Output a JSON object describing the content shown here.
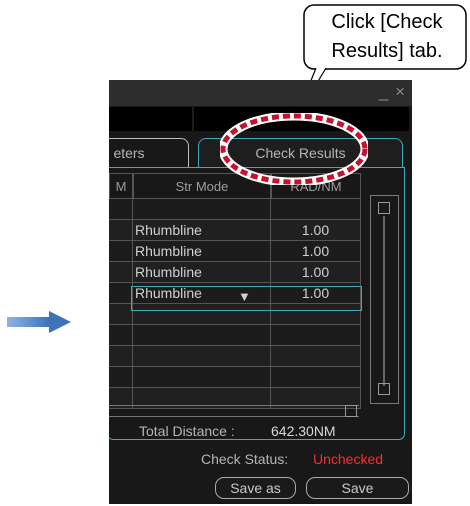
{
  "window": {
    "minimize_close": "_ ×"
  },
  "tabs": [
    {
      "label": "eters"
    },
    {
      "label": "Check Results"
    }
  ],
  "table": {
    "headers": [
      "M",
      "Str Mode",
      "RAD/NM"
    ],
    "rows": [
      {
        "mode": "",
        "rad": ""
      },
      {
        "mode": "Rhumbline",
        "rad": "1.00"
      },
      {
        "mode": "Rhumbline",
        "rad": "1.00"
      },
      {
        "mode": "Rhumbline",
        "rad": "1.00"
      },
      {
        "mode": "Rhumbline",
        "rad": "1.00"
      },
      {
        "mode": "",
        "rad": ""
      },
      {
        "mode": "",
        "rad": ""
      },
      {
        "mode": "",
        "rad": ""
      },
      {
        "mode": "",
        "rad": ""
      },
      {
        "mode": "",
        "rad": ""
      }
    ],
    "dropdown_symbol": "▼"
  },
  "totals": {
    "distance_label": "Total Distance :",
    "distance_value": "642.30NM"
  },
  "status": {
    "label": "Check Status:",
    "value": "Unchecked"
  },
  "buttons": {
    "save_as": "Save as",
    "save": "Save"
  },
  "callout": {
    "line1": "Click [Check",
    "line2": "Results] tab."
  },
  "colors": {
    "accent": "#41a9b6",
    "unchecked": "#ff2a2a",
    "highlight_ellipse": "#c8102e",
    "arrow": "#4a7fc1"
  }
}
